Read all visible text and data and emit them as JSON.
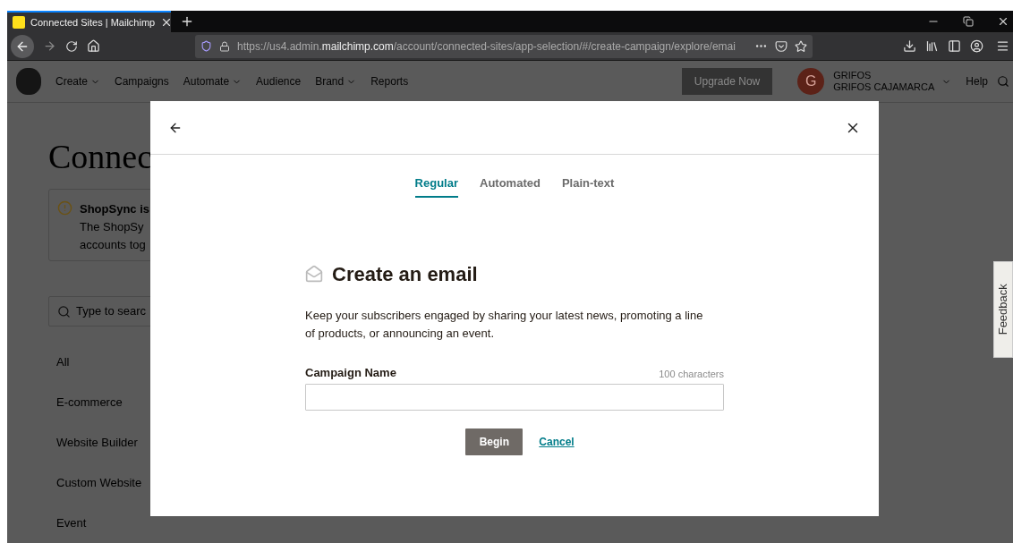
{
  "browser": {
    "tabs": [
      {
        "title": "Connected Sites | Mailchimp",
        "selected": true
      }
    ],
    "url": {
      "prefix": "https://us4.admin.",
      "domain": "mailchimp.com",
      "path": "/account/connected-sites/app-selection/#/create-campaign/explore/emai"
    }
  },
  "nav": {
    "items": [
      {
        "label": "Create",
        "dropdown": true
      },
      {
        "label": "Campaigns",
        "dropdown": false
      },
      {
        "label": "Automate",
        "dropdown": true
      },
      {
        "label": "Audience",
        "dropdown": false
      },
      {
        "label": "Brand",
        "dropdown": true
      },
      {
        "label": "Reports",
        "dropdown": false
      }
    ],
    "upgrade": "Upgrade Now",
    "account": {
      "initial": "G",
      "name": "GRIFOS",
      "org": "GRIFOS CAJAMARCA"
    },
    "help": "Help"
  },
  "page": {
    "title": "Connec",
    "alert": {
      "title": "ShopSync is",
      "lines": [
        "The ShopSy",
        "accounts tog"
      ]
    },
    "search": {
      "placeholder": "Type to searc"
    },
    "categories": [
      "All",
      "E-commerce",
      "Website Builder",
      "Custom Website",
      "Event"
    ]
  },
  "modal": {
    "tabs": [
      {
        "label": "Regular",
        "selected": true
      },
      {
        "label": "Automated",
        "selected": false
      },
      {
        "label": "Plain-text",
        "selected": false
      }
    ],
    "heading": "Create an email",
    "description": "Keep your subscribers engaged by sharing your latest news, promoting a line of products, or announcing an event.",
    "field": {
      "label": "Campaign Name",
      "counter": "100 characters"
    },
    "buttons": {
      "primary": "Begin",
      "secondary": "Cancel"
    }
  },
  "feedback": "Feedback"
}
